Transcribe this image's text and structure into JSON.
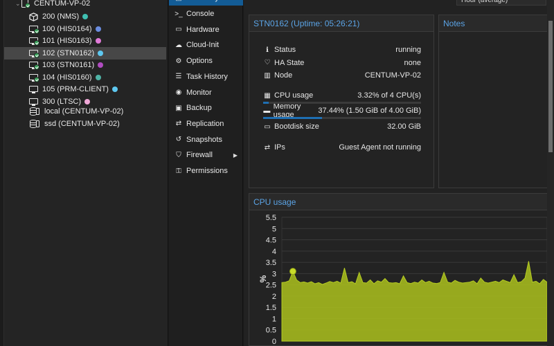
{
  "tree": {
    "node": "CENTUM-VP-02",
    "guests": [
      {
        "id": "200",
        "name": "200 (NMS)",
        "kind": "container",
        "running": false,
        "color": "#3fbfb1",
        "selected": false
      },
      {
        "id": "100",
        "name": "100 (HIS0164)",
        "kind": "vm",
        "running": true,
        "color": "#6b8de0",
        "selected": false
      },
      {
        "id": "101",
        "name": "101 (HIS0163)",
        "kind": "vm",
        "running": true,
        "color": "#e07ad8",
        "selected": false
      },
      {
        "id": "102",
        "name": "102 (STN0162)",
        "kind": "vm",
        "running": true,
        "color": "#5ec8f0",
        "selected": true
      },
      {
        "id": "103",
        "name": "103 (STN0161)",
        "kind": "vm",
        "running": true,
        "color": "#b04cc0",
        "selected": false
      },
      {
        "id": "104",
        "name": "104 (HIS0160)",
        "kind": "vm",
        "running": true,
        "color": "#4fb3a6",
        "selected": false
      },
      {
        "id": "105",
        "name": "105 (PRM-CLIENT)",
        "kind": "vm",
        "running": false,
        "color": "#5ec8f0",
        "selected": false
      },
      {
        "id": "300",
        "name": "300 (LTSC)",
        "kind": "vm",
        "running": false,
        "color": "#f0a8d8",
        "selected": false
      }
    ],
    "storages": [
      {
        "name": "local (CENTUM-VP-02)"
      },
      {
        "name": "ssd (CENTUM-VP-02)"
      }
    ]
  },
  "nav": {
    "items": [
      {
        "label": "Summary",
        "icon": "book-icon",
        "glyph": "▤",
        "active": true
      },
      {
        "label": "Console",
        "icon": "terminal-icon",
        "glyph": ">_",
        "active": false
      },
      {
        "label": "Hardware",
        "icon": "desktop-icon",
        "glyph": "▭",
        "active": false
      },
      {
        "label": "Cloud-Init",
        "icon": "cloud-icon",
        "glyph": "☁",
        "active": false
      },
      {
        "label": "Options",
        "icon": "gear-icon",
        "glyph": "⚙",
        "active": false
      },
      {
        "label": "Task History",
        "icon": "list-icon",
        "glyph": "☰",
        "active": false
      },
      {
        "label": "Monitor",
        "icon": "eye-icon",
        "glyph": "◉",
        "active": false
      },
      {
        "label": "Backup",
        "icon": "floppy-icon",
        "glyph": "▣",
        "active": false
      },
      {
        "label": "Replication",
        "icon": "retweet-icon",
        "glyph": "⇄",
        "active": false
      },
      {
        "label": "Snapshots",
        "icon": "history-icon",
        "glyph": "↺",
        "active": false
      },
      {
        "label": "Firewall",
        "icon": "shield-icon",
        "glyph": "⛉",
        "active": false,
        "submenu": true
      },
      {
        "label": "Permissions",
        "icon": "unlock-icon",
        "glyph": "⚿",
        "active": false
      }
    ]
  },
  "timeframe": "Hour (average)",
  "status": {
    "title": "STN0162 (Uptime: 05:26:21)",
    "rows": [
      {
        "key": "Status",
        "value": "running",
        "icon": "info-icon",
        "glyph": "ℹ"
      },
      {
        "key": "HA State",
        "value": "none",
        "icon": "heartbeat-icon",
        "glyph": "♡"
      },
      {
        "key": "Node",
        "value": "CENTUM-VP-02",
        "icon": "building-icon",
        "glyph": "▥"
      }
    ],
    "cpu": {
      "key": "CPU usage",
      "value": "3.32% of 4 CPU(s)",
      "icon": "cpu-icon",
      "glyph": "▦",
      "fraction": 0.0332
    },
    "memory": {
      "key": "Memory usage",
      "value": "37.44% (1.50 GiB of 4.00 GiB)",
      "icon": "memory-icon",
      "glyph": "▬",
      "fraction": 0.3744
    },
    "bootdisk": {
      "key": "Bootdisk size",
      "value": "32.00 GiB",
      "icon": "hdd-icon",
      "glyph": "▭"
    },
    "ips": {
      "key": "IPs",
      "value": "Guest Agent not running",
      "icon": "exchange-icon",
      "glyph": "⇄"
    }
  },
  "notes": {
    "title": "Notes"
  },
  "cpu_chart": {
    "title": "CPU usage"
  },
  "chart_data": {
    "type": "area",
    "title": "CPU usage",
    "xlabel": "",
    "ylabel": "%",
    "ylim": [
      0,
      5.5
    ],
    "y_ticks": [
      "0",
      "0.5",
      "1",
      "1.5",
      "2",
      "2.5",
      "3",
      "3.5",
      "4",
      "4.5",
      "5",
      "5.5"
    ],
    "grid": true,
    "series": [
      {
        "name": "",
        "color": "#a7bc1e",
        "values": [
          2.6,
          2.62,
          2.68,
          3.1,
          2.72,
          2.6,
          2.63,
          2.58,
          2.64,
          2.55,
          2.6,
          2.52,
          2.58,
          2.65,
          2.6,
          2.66,
          2.58,
          3.25,
          2.6,
          2.64,
          2.55,
          3.05,
          2.6,
          2.58,
          2.72,
          2.55,
          2.68,
          2.62,
          2.78,
          2.6,
          2.58,
          2.6,
          2.55,
          2.9,
          2.6,
          2.56,
          2.62,
          2.58,
          2.72,
          2.6,
          2.66,
          2.58,
          2.56,
          2.6,
          3.05,
          2.62,
          2.58,
          2.7,
          2.62,
          2.58,
          2.6,
          2.62,
          2.68,
          2.55,
          2.8,
          2.62,
          2.58,
          2.62,
          2.66,
          2.6,
          2.72,
          2.66,
          2.6,
          2.95,
          2.6,
          2.64,
          2.8,
          3.55,
          2.62,
          2.66,
          2.55,
          2.74,
          2.62
        ]
      }
    ],
    "highlight_point": {
      "index": 3,
      "value": 3.1
    }
  }
}
